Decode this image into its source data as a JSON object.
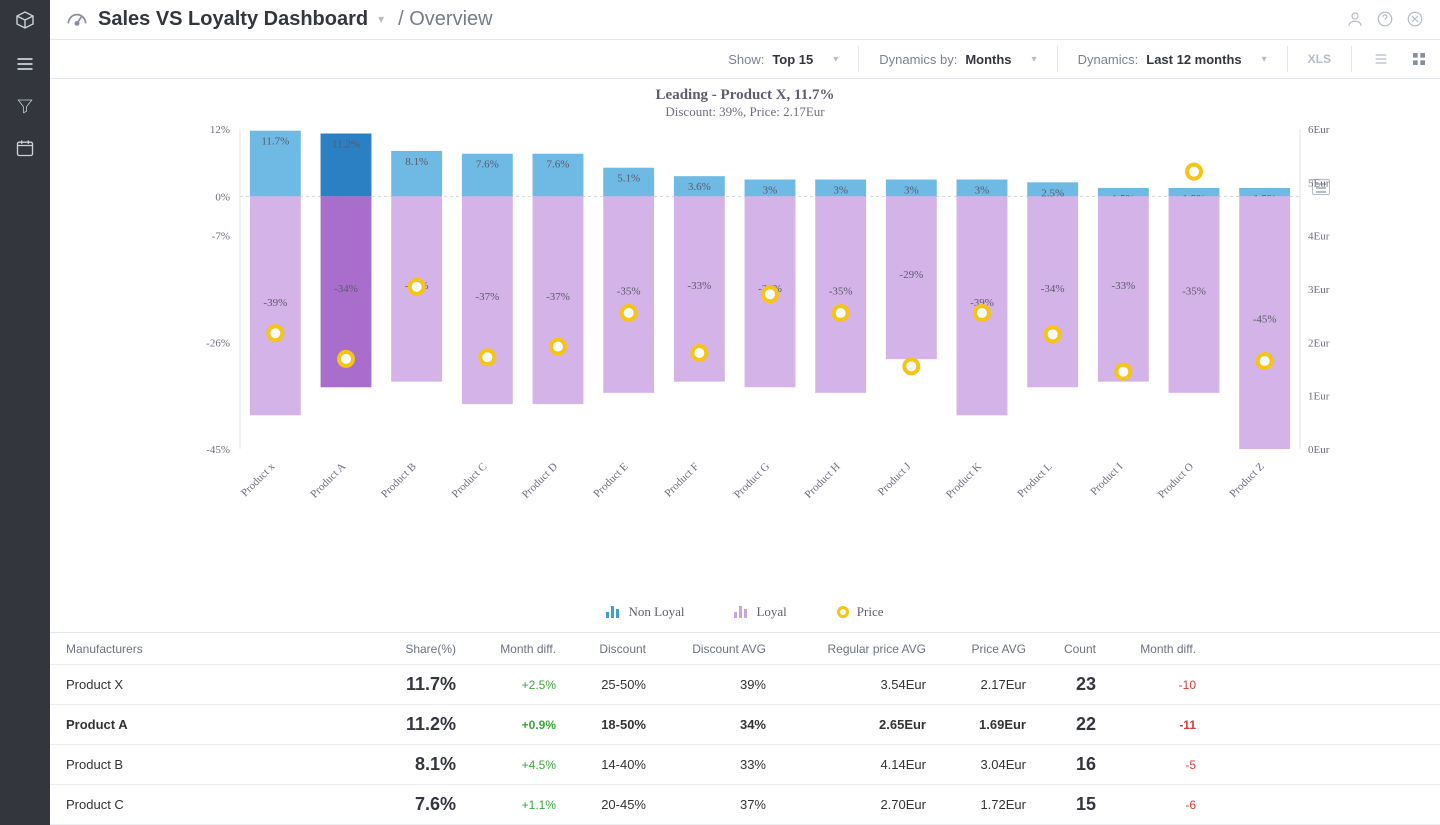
{
  "header": {
    "title": "Sales VS Loyalty Dashboard",
    "crumb": "/  Overview"
  },
  "toolbar": {
    "show_label": "Show:",
    "show_value": "Top 15",
    "dynamics_by_label": "Dynamics by:",
    "dynamics_by_value": "Months",
    "dynamics_label": "Dynamics:",
    "dynamics_value": "Last 12 months",
    "xls": "XLS"
  },
  "chart_title": "Leading - Product X, 11.7%",
  "chart_sub": "Discount: 39%, Price: 2.17Eur",
  "legend": {
    "non_loyal": "Non Loyal",
    "loyal": "Loyal",
    "price": "Price"
  },
  "chart_data": {
    "type": "bar",
    "title": "Leading - Product X, 11.7%",
    "subtitle": "Discount: 39%, Price: 2.17Eur",
    "categories": [
      "Product x",
      "Product A",
      "Product B",
      "Product C",
      "Product D",
      "Product E",
      "Product F",
      "Product G",
      "Product H",
      "Product J",
      "Product K",
      "Product L",
      "Product I",
      "Product O",
      "Product Z"
    ],
    "y_left": {
      "label": "",
      "ticks": [
        12,
        0,
        -7,
        -26,
        -45
      ],
      "unit": "%"
    },
    "y_right": {
      "label": "",
      "ticks": [
        6,
        5,
        4,
        3,
        2,
        1,
        0
      ],
      "unit": "Eur"
    },
    "series": [
      {
        "name": "Non Loyal",
        "axis": "left",
        "values": [
          11.7,
          11.2,
          8.1,
          7.6,
          7.6,
          5.1,
          3.6,
          3,
          3,
          3,
          3,
          2.5,
          1.5,
          1.5,
          1.5
        ]
      },
      {
        "name": "Loyal",
        "axis": "left",
        "values": [
          -39,
          -34,
          -33,
          -37,
          -37,
          -35,
          -33,
          -34,
          -35,
          -29,
          -39,
          -34,
          -33,
          -35,
          -45
        ]
      },
      {
        "name": "Price",
        "axis": "right",
        "type": "scatter",
        "values": [
          2.17,
          1.69,
          3.04,
          1.72,
          1.92,
          2.55,
          1.8,
          2.9,
          2.55,
          1.55,
          2.55,
          2.15,
          1.45,
          5.2,
          1.65
        ]
      }
    ],
    "highlight_index": 1
  },
  "table": {
    "headers": [
      "Manufacturers",
      "Share(%)",
      "Month diff.",
      "Discount",
      "Discount AVG",
      "Regular price AVG",
      "Price AVG",
      "Count",
      "Month diff."
    ],
    "rows": [
      {
        "name": "Product X",
        "share": "11.7%",
        "mdiff": "+2.5%",
        "discount": "25-50%",
        "discount_avg": "39%",
        "rp": "3.54Eur",
        "price": "2.17Eur",
        "count": "23",
        "cdiff": "-10",
        "selected": false
      },
      {
        "name": "Product A",
        "share": "11.2%",
        "mdiff": "+0.9%",
        "discount": "18-50%",
        "discount_avg": "34%",
        "rp": "2.65Eur",
        "price": "1.69Eur",
        "count": "22",
        "cdiff": "-11",
        "selected": true
      },
      {
        "name": "Product B",
        "share": "8.1%",
        "mdiff": "+4.5%",
        "discount": "14-40%",
        "discount_avg": "33%",
        "rp": "4.14Eur",
        "price": "3.04Eur",
        "count": "16",
        "cdiff": "-5",
        "selected": false
      },
      {
        "name": "Product C",
        "share": "7.6%",
        "mdiff": "+1.1%",
        "discount": "20-45%",
        "discount_avg": "37%",
        "rp": "2.70Eur",
        "price": "1.72Eur",
        "count": "15",
        "cdiff": "-6",
        "selected": false
      }
    ]
  }
}
